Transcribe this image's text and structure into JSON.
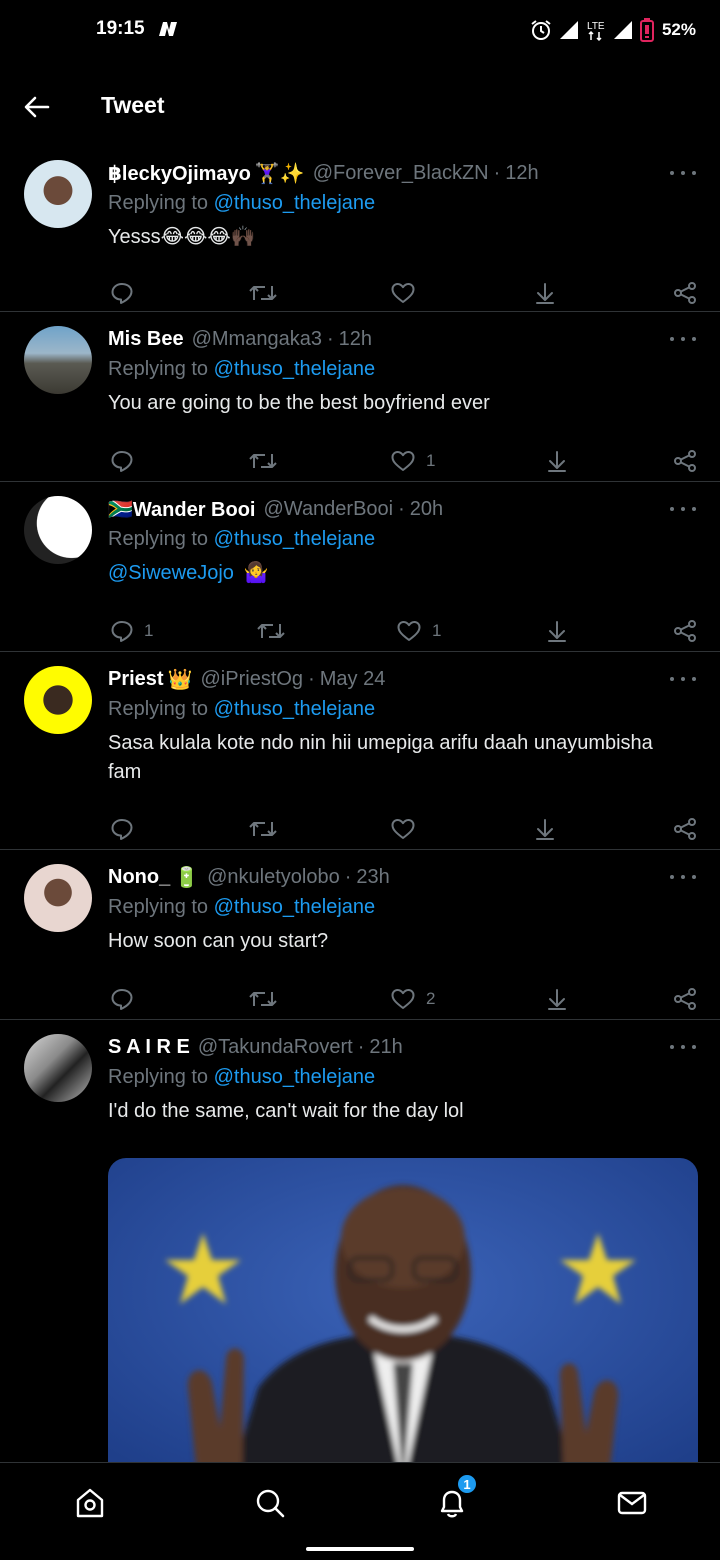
{
  "status_bar": {
    "time": "19:15",
    "battery": "52%",
    "network": "LTE"
  },
  "header": {
    "title": "Tweet"
  },
  "tweets": [
    {
      "name": "฿leckyOjimayo",
      "badge": "🏋️‍♀️✨",
      "handle": "@Forever_BlackZN",
      "time": "12h",
      "replying_prefix": "Replying to ",
      "replying_to": "@thuso_thelejane",
      "text": "Yesss😂😂😂🙌🏿",
      "reply_count": "",
      "like_count": ""
    },
    {
      "name": "Mis Bee",
      "badge": "",
      "handle": "@Mmangaka3",
      "time": "12h",
      "replying_prefix": "Replying to ",
      "replying_to": "@thuso_thelejane",
      "text": "You are going to be the best boyfriend ever",
      "reply_count": "",
      "like_count": "1"
    },
    {
      "name": "🇿🇦Wander Booi",
      "badge": "",
      "handle": "@WanderBooi",
      "time": "20h",
      "replying_prefix": "Replying to ",
      "replying_to": "@thuso_thelejane",
      "text": "@SiwewеJojo",
      "text_emoji": "🤷‍♀️",
      "reply_count": "1",
      "like_count": "1"
    },
    {
      "name": "Priest",
      "badge": "👑",
      "handle": "@iPriestOg",
      "time": "May 24",
      "replying_prefix": "Replying to ",
      "replying_to": "@thuso_thelejane",
      "text": "Sasa kulala kote ndo nin hii umepiga arifu daah unayumbisha fam",
      "reply_count": "",
      "like_count": ""
    },
    {
      "name": "Nono_",
      "badge": "🔋",
      "handle": "@nkuletyolobo",
      "time": "23h",
      "replying_prefix": "Replying to ",
      "replying_to": "@thuso_thelejane",
      "text": "How soon can you start?",
      "reply_count": "",
      "like_count": "2"
    },
    {
      "name": "S A I R E",
      "badge": "",
      "handle": "@TakundaRovert",
      "time": "21h",
      "replying_prefix": "Replying to ",
      "replying_to": "@thuso_thelejane",
      "text": "I'd do the same, can't wait for the day lol"
    }
  ],
  "bottom_nav": {
    "items": [
      "home-icon",
      "search-icon",
      "notifications-icon",
      "messages-icon"
    ],
    "notification_count": "1"
  },
  "colors": {
    "accent": "#1d9bf0",
    "muted": "#6e767d",
    "background": "#000000",
    "divider": "#2f3336"
  }
}
